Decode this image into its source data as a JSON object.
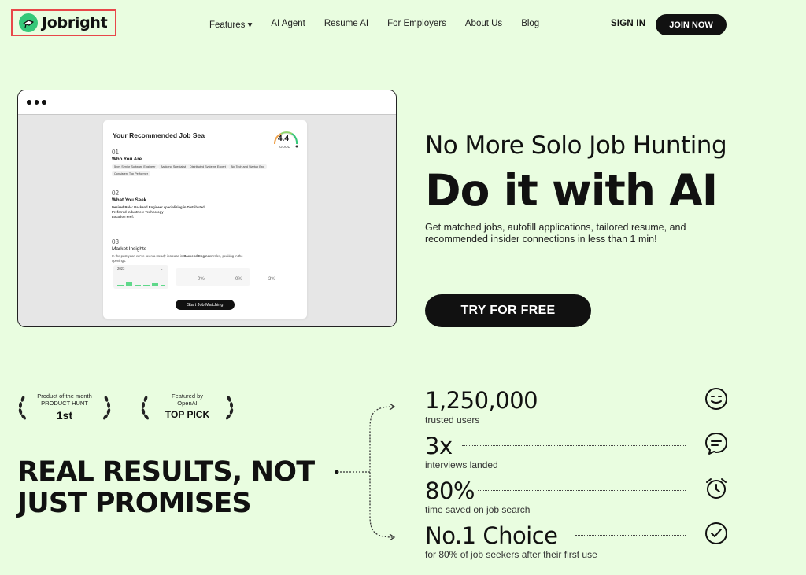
{
  "header": {
    "logo": "Jobright",
    "nav": [
      "Features ▾",
      "AI Agent",
      "Resume AI",
      "For Employers",
      "About Us",
      "Blog"
    ],
    "sign_in": "SIGN IN",
    "join_now": "JOIN NOW"
  },
  "mockup": {
    "title": "Your Recommended Job Sea",
    "score": "4.4",
    "score_label": "GOOD",
    "s1_num": "01",
    "s1_title": "Who You Are",
    "chips": [
      "5 yrs Senior Software Engineer",
      "Backend Specialist",
      "Distributed Systems Expert",
      "Big Tech and Startup Exp",
      "Consistent Top Performer"
    ],
    "s2_num": "02",
    "s2_title": "What You Seek",
    "seek_lines": [
      "Desired Role: Backend Engineer specializing in Distributed",
      "Preferred Industries: Technology",
      "Location Pref:"
    ],
    "s3_num": "03",
    "s3_title": "Market Insights",
    "insight_text_a": "In the past year, we've seen a steady increase in ",
    "insight_bold": "Backend Engineer",
    "insight_text_b": " roles, peaking in the",
    "insight_text_c": "openings:",
    "mini_year": "2023",
    "mini_l": "L",
    "pct1": "0%",
    "pct2": "0%",
    "pct3": "3%",
    "start_button": "Start Job Matching"
  },
  "hero": {
    "subtitle": "No More Solo Job Hunting",
    "title": "Do it with AI",
    "description": "Get matched jobs, autofill applications, tailored resume, and recommended insider connections in less than 1 min!",
    "cta": "TRY FOR FREE"
  },
  "badges": [
    {
      "line1": "Product of the month",
      "line2": "PRODUCT HUNT",
      "line3": "1st"
    },
    {
      "line1": "Featured by",
      "line2": "OpenAI",
      "line3": "TOP PICK"
    }
  ],
  "results_heading": [
    "REAL RESULTS, NOT",
    "JUST PROMISES"
  ],
  "stats": [
    {
      "value": "1,250,000",
      "label": "trusted users",
      "icon": "smile-icon"
    },
    {
      "value": "3x",
      "label": "interviews landed",
      "icon": "chat-bubble-icon"
    },
    {
      "value": "80%",
      "label": "time saved on job search",
      "icon": "alarm-clock-icon"
    },
    {
      "value": "No.1 Choice",
      "label": "for 80% of job seekers after their first use",
      "icon": "check-circle-icon"
    }
  ],
  "colors": {
    "background": "#e9fde0",
    "dark": "#111111",
    "accent_green": "#35c879",
    "highlight_border": "#e8474a"
  }
}
